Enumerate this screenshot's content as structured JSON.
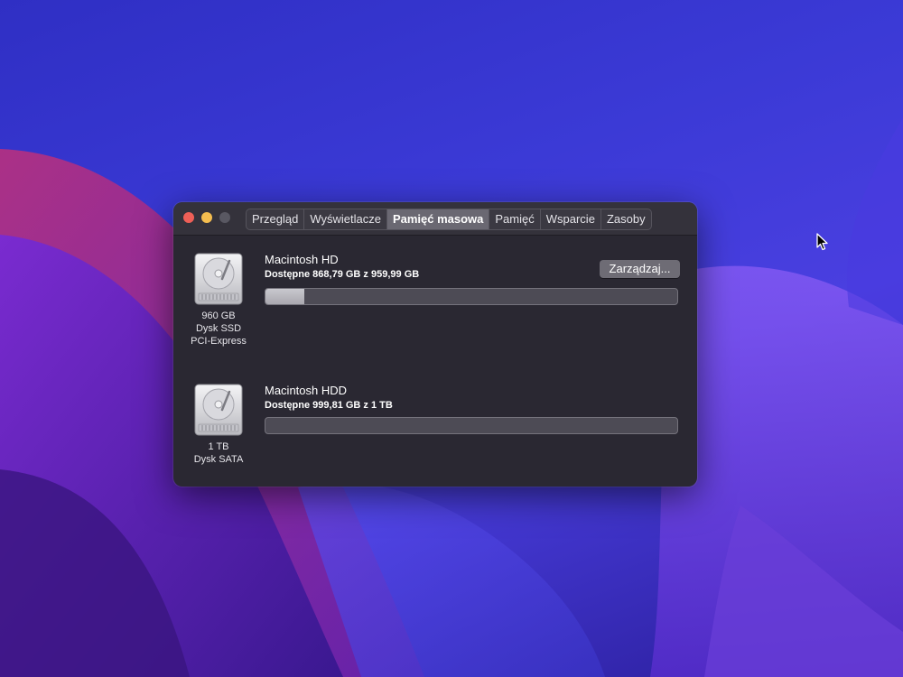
{
  "tabs": [
    {
      "label": "Przegląd"
    },
    {
      "label": "Wyświetlacze"
    },
    {
      "label": "Pamięć masowa"
    },
    {
      "label": "Pamięć"
    },
    {
      "label": "Wsparcie"
    },
    {
      "label": "Zasoby"
    }
  ],
  "active_tab": "Pamięć masowa",
  "disks": [
    {
      "name": "Macintosh HD",
      "available": "Dostępne 868,79 GB z 959,99 GB",
      "capacity": "960 GB",
      "type": "Dysk SSD",
      "interface": "PCI-Express",
      "used_fraction": 0.095,
      "manage_label": "Zarządzaj..."
    },
    {
      "name": "Macintosh HDD",
      "available": "Dostępne 999,81 GB z 1 TB",
      "capacity": "1 TB",
      "type": "Dysk SATA",
      "used_fraction": 0.0
    }
  ],
  "colors": {
    "close": "#ee5f57",
    "minimize": "#f4bd4f",
    "zoom_disabled": "#595862",
    "window_bg": "#2a2832"
  },
  "icons": [
    "close-button",
    "minimize-button",
    "zoom-button",
    "hard-drive-icon",
    "mouse-pointer-icon"
  ]
}
